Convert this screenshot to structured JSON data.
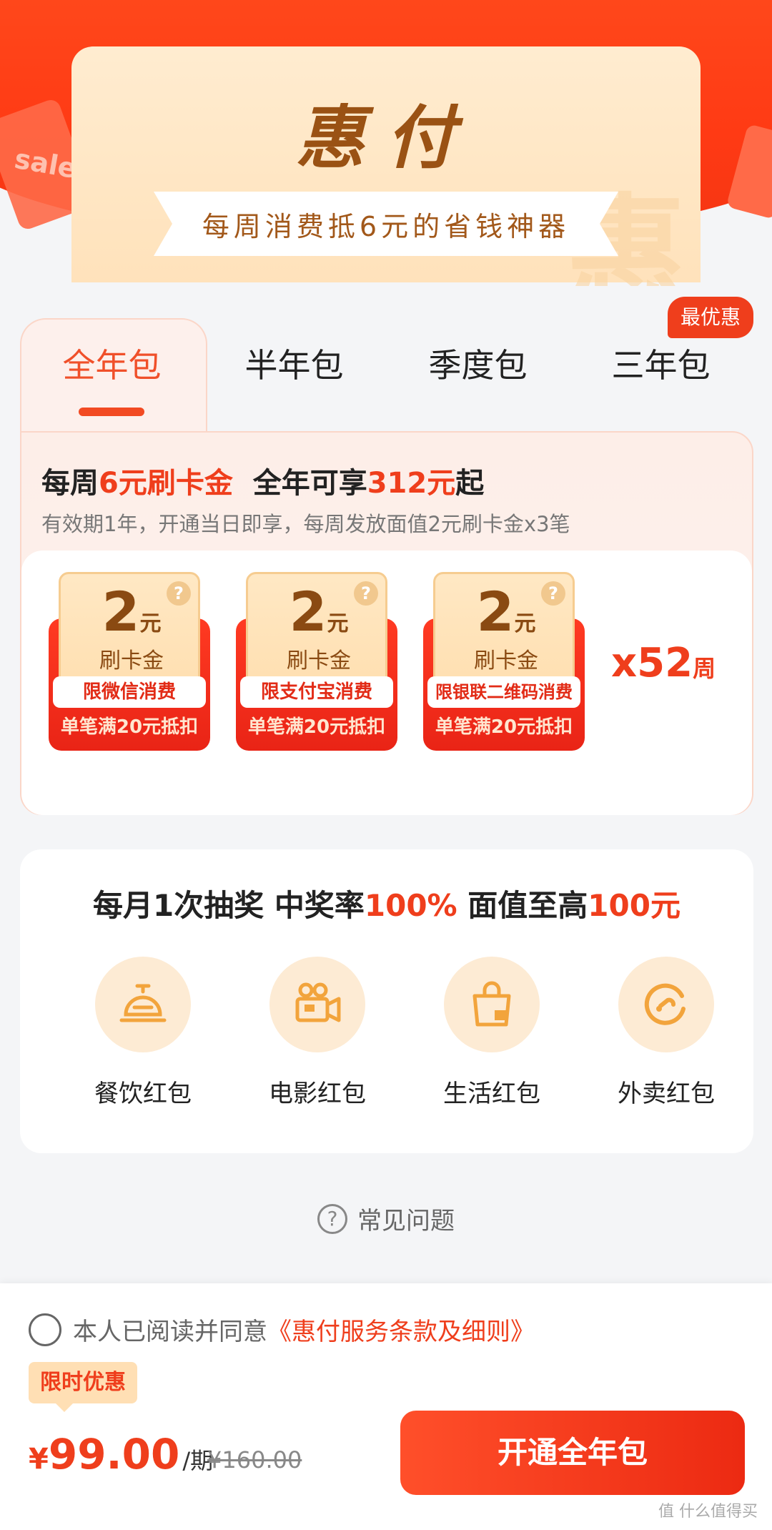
{
  "hero": {
    "title": "惠付",
    "subtitle": "每周消费抵6元的省钱神器",
    "deco_text": "sale"
  },
  "tabs": {
    "items": [
      "全年包",
      "半年包",
      "季度包",
      "三年包"
    ],
    "active_index": 0,
    "best_badge": "最优惠"
  },
  "package": {
    "headline": {
      "p1": "每周",
      "hl1": "6元刷卡金",
      "p2": "全年可享",
      "hl2": "312元",
      "p3": "起"
    },
    "sub": "有效期1年，开通当日即享，每周发放面值2元刷卡金x3笔",
    "coupons": [
      {
        "amount": "2",
        "unit": "元",
        "name": "刷卡金",
        "limit": "限微信消费",
        "cond": "单笔满20元抵扣"
      },
      {
        "amount": "2",
        "unit": "元",
        "name": "刷卡金",
        "limit": "限支付宝消费",
        "cond": "单笔满20元抵扣"
      },
      {
        "amount": "2",
        "unit": "元",
        "name": "刷卡金",
        "limit": "限银联二维码消费",
        "cond": "单笔满20元抵扣"
      }
    ],
    "weeks": {
      "count": "x52",
      "unit": "周"
    },
    "help_icon": "?"
  },
  "lottery": {
    "title": {
      "p1": "每月1次抽奖 中奖率",
      "hl1": "100%",
      "p2": " 面值至高",
      "hl2": "100元"
    },
    "items": [
      {
        "label": "餐饮红包",
        "icon": "dining-bell-icon"
      },
      {
        "label": "电影红包",
        "icon": "movie-camera-icon"
      },
      {
        "label": "生活红包",
        "icon": "shopping-bag-icon"
      },
      {
        "label": "外卖红包",
        "icon": "delivery-icon"
      }
    ]
  },
  "faq": {
    "label": "常见问题",
    "icon": "?"
  },
  "bottom": {
    "agree_text": "本人已阅读并同意",
    "agree_link": "《惠付服务条款及细则》",
    "promo_tag": "限时优惠",
    "price_currency": "¥",
    "price_amount": "99.00",
    "price_period": "/期",
    "orig_price": "¥160.00",
    "cta": "开通全年包"
  },
  "watermark": "值 什么值得买",
  "colors": {
    "accent": "#ef3e1c",
    "gold": "#8a4a12",
    "cream": "#ffe2bb"
  }
}
